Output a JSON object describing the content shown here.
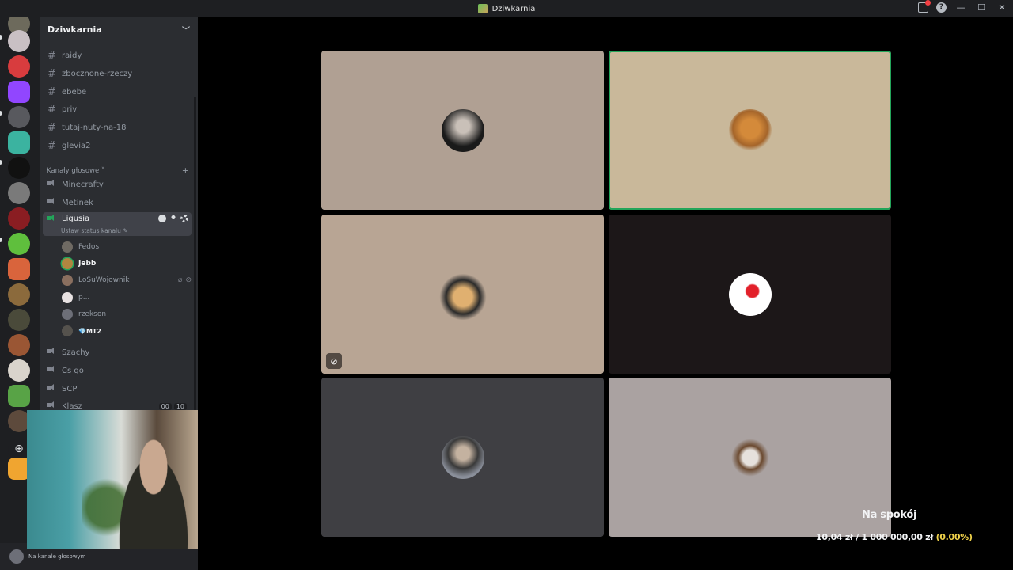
{
  "window": {
    "title": "Dziwkarnia"
  },
  "guild": {
    "name": "Dziwkarnia"
  },
  "text_channels": [
    "raidy",
    "zbocznone-rzeczy",
    "ebebe",
    "priv",
    "tutaj-nuty-na-18",
    "glevia2"
  ],
  "voice_category": {
    "label": "Kanały głosowe",
    "add": "+"
  },
  "voice_channels": {
    "minecrafty": "Minecrafty",
    "metinek": "Metinek",
    "ligusia": "Ligusia",
    "ligusia_status": "Ustaw status kanału",
    "szachy": "Szachy",
    "csgo": "Cs go",
    "scp": "SCP",
    "klasz": "Klasz",
    "klasz_badges": [
      "00",
      "10"
    ]
  },
  "voice_users": [
    {
      "name": "Fedos",
      "bright": false
    },
    {
      "name": "Jebb",
      "bright": true
    },
    {
      "name": "LoSuWojownik",
      "bright": false
    },
    {
      "name": "p...",
      "bright": false
    },
    {
      "name": "rzekson",
      "bright": false
    },
    {
      "name": "💎MT2",
      "bright": true
    }
  ],
  "user_panel": {
    "status": "Na kanale głosowym"
  },
  "overlay": {
    "title": "Na spokój",
    "amount": "10,04 zł / 1 000 000,00 zł",
    "percent": "(0.00%)"
  },
  "colors": {
    "speaking": "#23a55a",
    "tile_1": "#b0a093",
    "tile_2": "#c9b89a",
    "tile_3": "#b8a594",
    "tile_4": "#1c1718",
    "tile_5": "#3f3f43",
    "tile_6": "#aaa2a1"
  }
}
